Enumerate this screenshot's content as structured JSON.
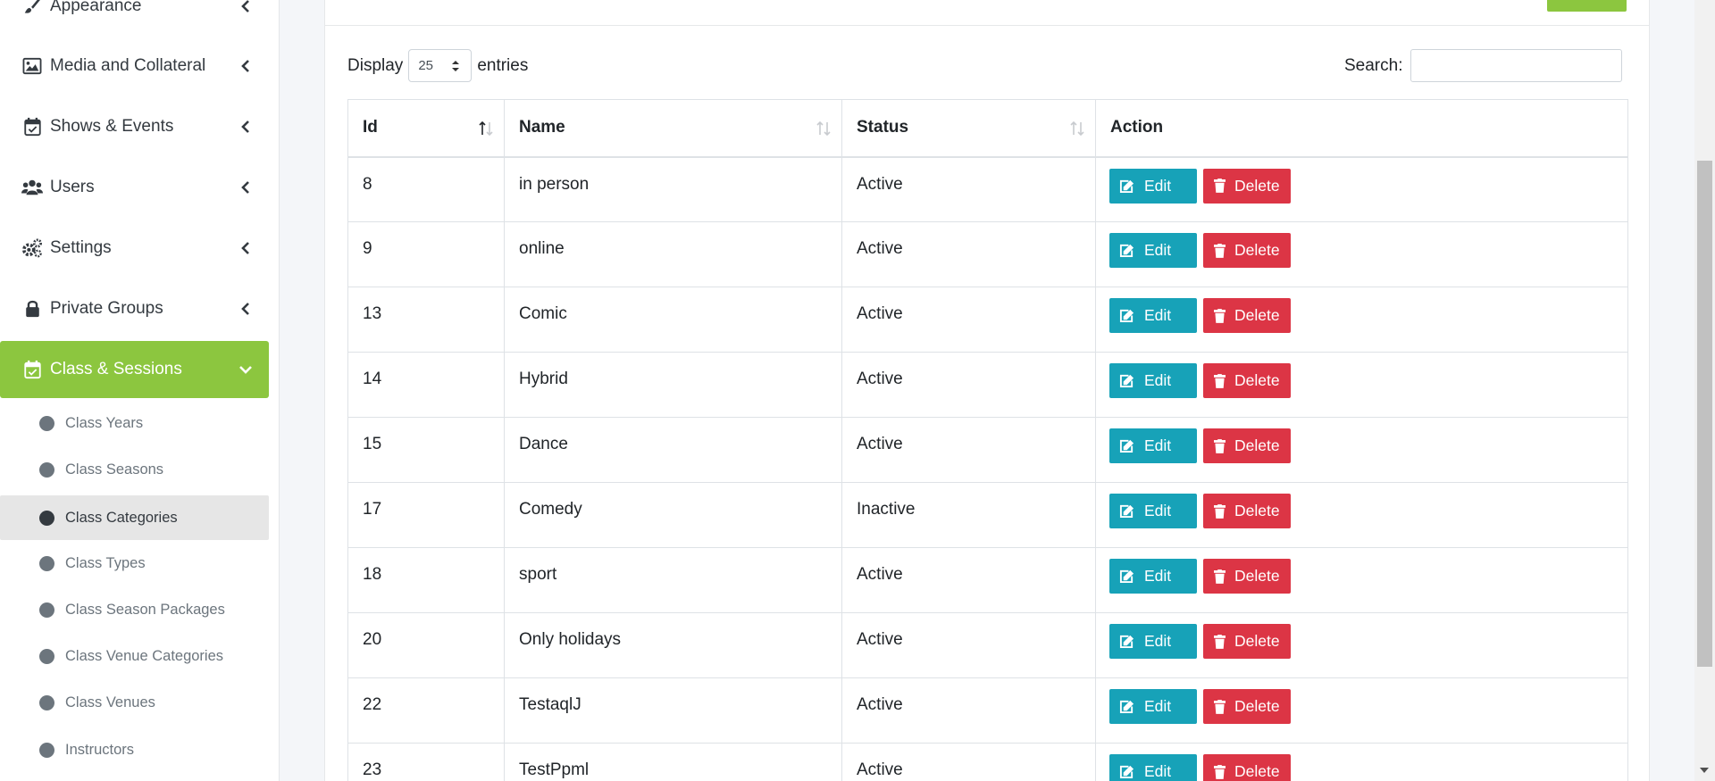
{
  "sidebar": {
    "items": [
      {
        "label": "Appearance",
        "icon": "paintbrush-icon",
        "active": false
      },
      {
        "label": "Media and Collateral",
        "icon": "image-icon",
        "active": false
      },
      {
        "label": "Shows & Events",
        "icon": "calendar-check-icon",
        "active": false
      },
      {
        "label": "Users",
        "icon": "users-icon",
        "active": false
      },
      {
        "label": "Settings",
        "icon": "gears-icon",
        "active": false
      },
      {
        "label": "Private Groups",
        "icon": "lock-icon",
        "active": false
      },
      {
        "label": "Class & Sessions",
        "icon": "calendar-check-icon",
        "active": true
      }
    ],
    "sub_items": [
      {
        "label": "Class Years",
        "current": false
      },
      {
        "label": "Class Seasons",
        "current": false
      },
      {
        "label": "Class Categories",
        "current": true
      },
      {
        "label": "Class Types",
        "current": false
      },
      {
        "label": "Class Season Packages",
        "current": false
      },
      {
        "label": "Class Venue Categories",
        "current": false
      },
      {
        "label": "Class Venues",
        "current": false
      },
      {
        "label": "Instructors",
        "current": false
      }
    ]
  },
  "controls": {
    "display_label": "Display",
    "page_size": "25",
    "entries_label": "entries",
    "search_label": "Search:",
    "search_value": ""
  },
  "table": {
    "headers": [
      "Id",
      "Name",
      "Status",
      "Action"
    ],
    "edit_label": "Edit",
    "delete_label": "Delete",
    "rows": [
      {
        "id": "8",
        "name": "in person",
        "status": "Active"
      },
      {
        "id": "9",
        "name": "online",
        "status": "Active"
      },
      {
        "id": "13",
        "name": "Comic",
        "status": "Active"
      },
      {
        "id": "14",
        "name": "Hybrid",
        "status": "Active"
      },
      {
        "id": "15",
        "name": "Dance",
        "status": "Active"
      },
      {
        "id": "17",
        "name": "Comedy",
        "status": "Inactive"
      },
      {
        "id": "18",
        "name": "sport",
        "status": "Active"
      },
      {
        "id": "20",
        "name": "Only holidays",
        "status": "Active"
      },
      {
        "id": "22",
        "name": "TestaqlJ",
        "status": "Active"
      },
      {
        "id": "23",
        "name": "TestPpml",
        "status": "Active"
      }
    ]
  },
  "colors": {
    "accent_green": "#8cc63f",
    "edit_teal": "#17a2b8",
    "delete_red": "#dc3545"
  }
}
